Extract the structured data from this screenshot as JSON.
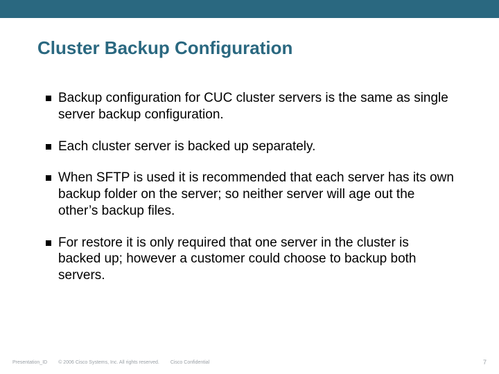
{
  "title": "Cluster Backup Configuration",
  "bullets": [
    "Backup configuration for CUC cluster servers is the same as single server backup configuration.",
    "Each cluster server is backed up separately.",
    "When SFTP is used it is recommended that each server has its own backup folder on the server; so neither server will age out the other’s backup files.",
    "For restore it is only required that one server in the cluster is backed up; however a customer could choose to backup both servers."
  ],
  "footer": {
    "pres_id": "Presentation_ID",
    "copyright": "© 2006 Cisco Systems, Inc. All rights reserved.",
    "confidential": "Cisco Confidential",
    "page_number": "7"
  },
  "colors": {
    "accent": "#2a6880"
  }
}
